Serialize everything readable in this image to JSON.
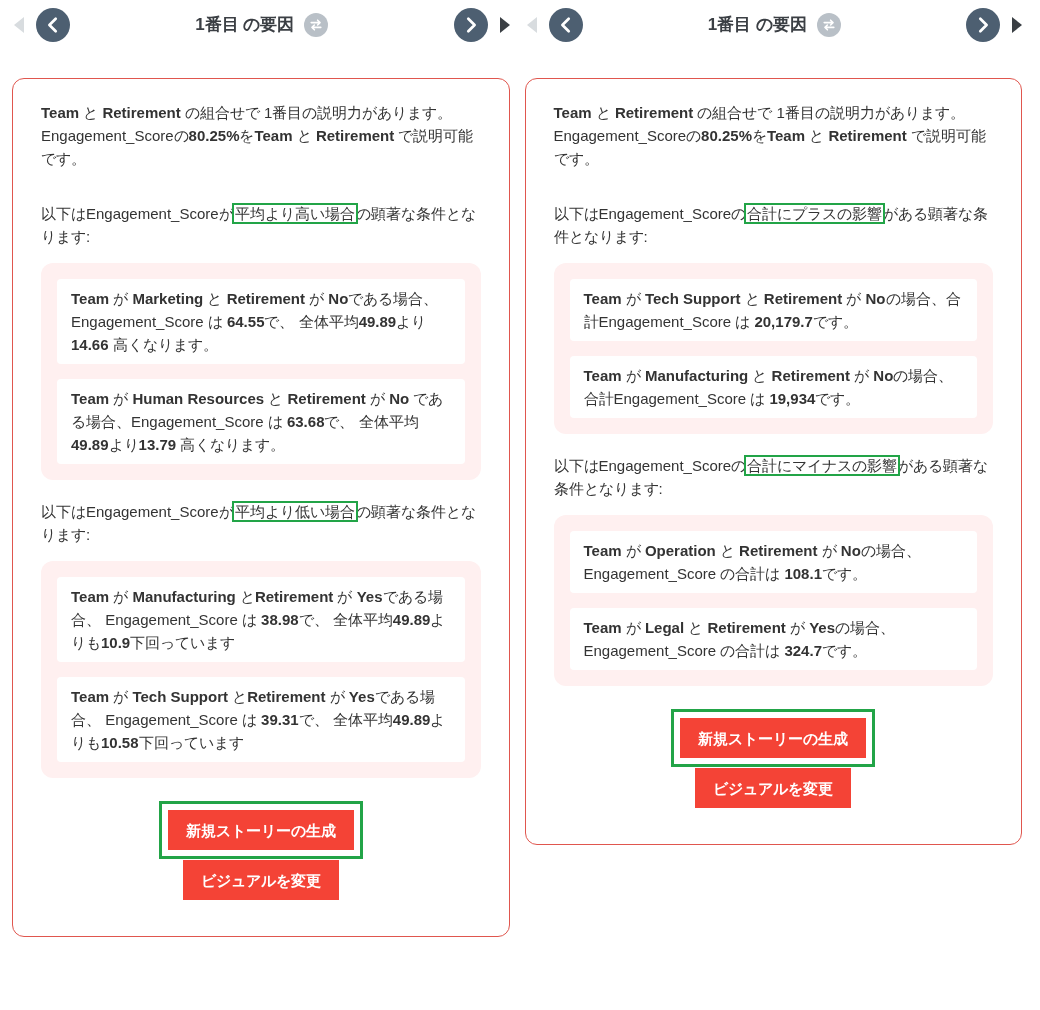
{
  "panels": [
    {
      "header": {
        "title": "1番目 の要因",
        "prev_disabled": true,
        "next_disabled": false
      },
      "summary": "**Team** と **Retirement** の組合せで 1番目の説明力があります。Engagement_Scoreの**80.25%**を**Team** と **Retirement** で説明可能です。",
      "sections": [
        {
          "intro_before": "以下はEngagement_Scoreが",
          "intro_highlight": "平均より高い場合",
          "intro_after": "の顕著な条件となります:",
          "conditions": [
            "**Team** が **Marketing** と **Retirement** が **No**である場合、Engagement_Score は **64.55**で、 全体平均**49.89**より**14.66** 高くなります。",
            "**Team** が **Human Resources** と **Retirement** が **No** である場合、Engagement_Score は **63.68**で、 全体平均**49.89**より**13.79** 高くなります。"
          ]
        },
        {
          "intro_before": "以下はEngagement_Scoreが",
          "intro_highlight": "平均より低い場合",
          "intro_after": "の顕著な条件となります:",
          "conditions": [
            "**Team** が **Manufacturing** と**Retirement** が **Yes**である場合、 Engagement_Score は **38.98**で、 全体平均**49.89**よりも**10.9**下回っています",
            "**Team** が **Tech Support** と**Retirement** が **Yes**である場合、 Engagement_Score は **39.31**で、 全体平均**49.89**よりも**10.58**下回っています"
          ]
        }
      ],
      "buttons": [
        {
          "label": "新規ストーリーの生成",
          "highlighted": true
        },
        {
          "label": "ビジュアルを変更",
          "highlighted": false
        }
      ]
    },
    {
      "header": {
        "title": "1番目 の要因",
        "prev_disabled": true,
        "next_disabled": false
      },
      "summary": "**Team** と **Retirement** の組合せで 1番目の説明力があります。Engagement_Scoreの**80.25%**を**Team** と **Retirement** で説明可能です。",
      "sections": [
        {
          "intro_before": "以下はEngagement_Scoreの",
          "intro_highlight": "合計にプラスの影響",
          "intro_after": "がある顕著な条件となります:",
          "conditions": [
            "**Team** が **Tech Support** と **Retirement** が **No**の場合、合計Engagement_Score は **20,179.7**です。",
            "**Team** が **Manufacturing** と **Retirement** が **No**の場合、合計Engagement_Score は **19,934**です。"
          ]
        },
        {
          "intro_before": "以下はEngagement_Scoreの",
          "intro_highlight": "合計にマイナスの影響",
          "intro_after": "がある顕著な条件となります:",
          "conditions": [
            "**Team** が **Operation** と **Retirement** が **No**の場合、Engagement_Score の合計は **108.1**です。",
            "**Team** が **Legal** と **Retirement** が **Yes**の場合、Engagement_Score の合計は **324.7**です。"
          ]
        }
      ],
      "buttons": [
        {
          "label": "新規ストーリーの生成",
          "highlighted": true
        },
        {
          "label": "ビジュアルを変更",
          "highlighted": false
        }
      ]
    }
  ]
}
